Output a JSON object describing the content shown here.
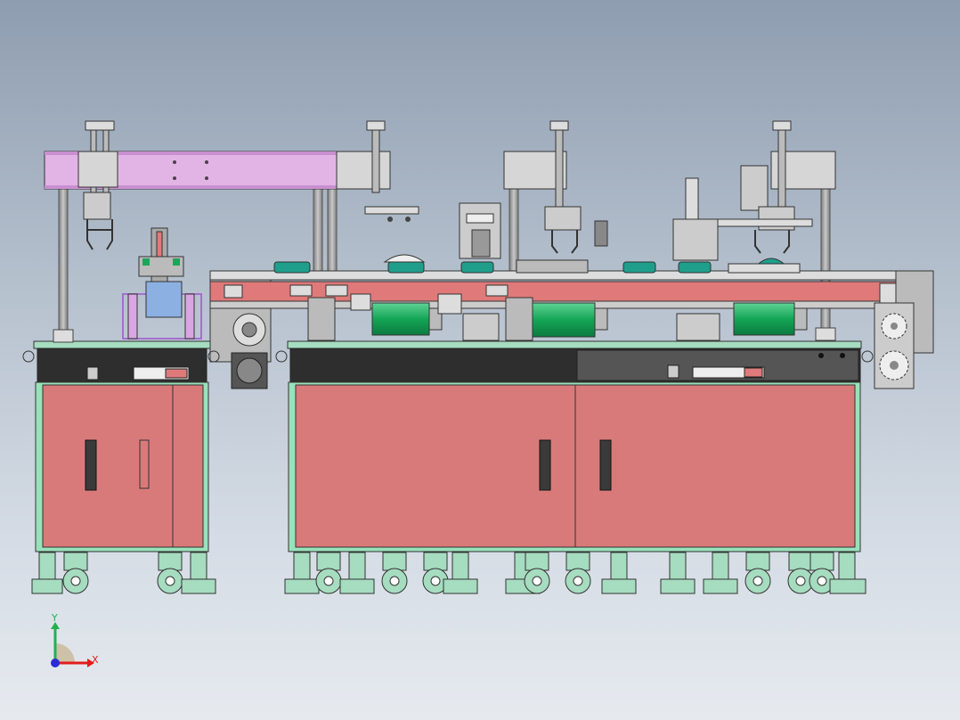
{
  "view": {
    "background_top": "#8e9db0",
    "background_bottom": "#e6eaef"
  },
  "axis_triad": {
    "x_label": "X",
    "y_label": "Y",
    "x_color": "#e21c1c",
    "y_color": "#22b14c",
    "z_color": "#2b2bd6"
  },
  "colors": {
    "cabinet_door": "#d97a7a",
    "cabinet_frame": "#98e2bb",
    "cabinet_top_panel": "#2e2e2e",
    "gantry_beam": "#e2b4e6",
    "conveyor_belt": "#e07a7a",
    "motor_green": "#18a85a",
    "tray_teal": "#1f9e8c",
    "caster_green": "#a6dcc0",
    "column_gray": "#9a9a9a"
  }
}
